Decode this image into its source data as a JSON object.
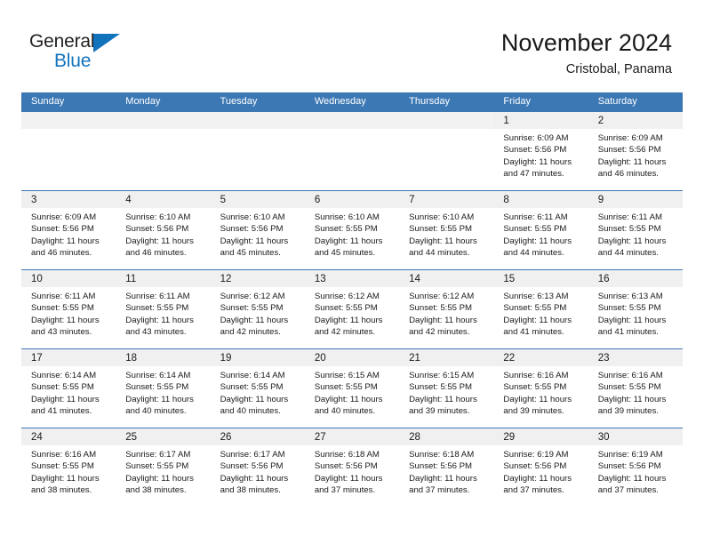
{
  "brand": {
    "name_part1": "General",
    "name_part2": "Blue",
    "triangle_color": "#1273bd"
  },
  "header": {
    "title": "November 2024",
    "subtitle": "Cristobal, Panama"
  },
  "theme": {
    "header_blue": "#3c78b4",
    "daynum_band": "#f0f0f0",
    "text": "#1a1a1a"
  },
  "weekday_headers": [
    "Sunday",
    "Monday",
    "Tuesday",
    "Wednesday",
    "Thursday",
    "Friday",
    "Saturday"
  ],
  "weeks": [
    [
      {
        "day": "",
        "lines": []
      },
      {
        "day": "",
        "lines": []
      },
      {
        "day": "",
        "lines": []
      },
      {
        "day": "",
        "lines": []
      },
      {
        "day": "",
        "lines": []
      },
      {
        "day": "1",
        "lines": [
          "Sunrise: 6:09 AM",
          "Sunset: 5:56 PM",
          "Daylight: 11 hours",
          "and 47 minutes."
        ]
      },
      {
        "day": "2",
        "lines": [
          "Sunrise: 6:09 AM",
          "Sunset: 5:56 PM",
          "Daylight: 11 hours",
          "and 46 minutes."
        ]
      }
    ],
    [
      {
        "day": "3",
        "lines": [
          "Sunrise: 6:09 AM",
          "Sunset: 5:56 PM",
          "Daylight: 11 hours",
          "and 46 minutes."
        ]
      },
      {
        "day": "4",
        "lines": [
          "Sunrise: 6:10 AM",
          "Sunset: 5:56 PM",
          "Daylight: 11 hours",
          "and 46 minutes."
        ]
      },
      {
        "day": "5",
        "lines": [
          "Sunrise: 6:10 AM",
          "Sunset: 5:56 PM",
          "Daylight: 11 hours",
          "and 45 minutes."
        ]
      },
      {
        "day": "6",
        "lines": [
          "Sunrise: 6:10 AM",
          "Sunset: 5:55 PM",
          "Daylight: 11 hours",
          "and 45 minutes."
        ]
      },
      {
        "day": "7",
        "lines": [
          "Sunrise: 6:10 AM",
          "Sunset: 5:55 PM",
          "Daylight: 11 hours",
          "and 44 minutes."
        ]
      },
      {
        "day": "8",
        "lines": [
          "Sunrise: 6:11 AM",
          "Sunset: 5:55 PM",
          "Daylight: 11 hours",
          "and 44 minutes."
        ]
      },
      {
        "day": "9",
        "lines": [
          "Sunrise: 6:11 AM",
          "Sunset: 5:55 PM",
          "Daylight: 11 hours",
          "and 44 minutes."
        ]
      }
    ],
    [
      {
        "day": "10",
        "lines": [
          "Sunrise: 6:11 AM",
          "Sunset: 5:55 PM",
          "Daylight: 11 hours",
          "and 43 minutes."
        ]
      },
      {
        "day": "11",
        "lines": [
          "Sunrise: 6:11 AM",
          "Sunset: 5:55 PM",
          "Daylight: 11 hours",
          "and 43 minutes."
        ]
      },
      {
        "day": "12",
        "lines": [
          "Sunrise: 6:12 AM",
          "Sunset: 5:55 PM",
          "Daylight: 11 hours",
          "and 42 minutes."
        ]
      },
      {
        "day": "13",
        "lines": [
          "Sunrise: 6:12 AM",
          "Sunset: 5:55 PM",
          "Daylight: 11 hours",
          "and 42 minutes."
        ]
      },
      {
        "day": "14",
        "lines": [
          "Sunrise: 6:12 AM",
          "Sunset: 5:55 PM",
          "Daylight: 11 hours",
          "and 42 minutes."
        ]
      },
      {
        "day": "15",
        "lines": [
          "Sunrise: 6:13 AM",
          "Sunset: 5:55 PM",
          "Daylight: 11 hours",
          "and 41 minutes."
        ]
      },
      {
        "day": "16",
        "lines": [
          "Sunrise: 6:13 AM",
          "Sunset: 5:55 PM",
          "Daylight: 11 hours",
          "and 41 minutes."
        ]
      }
    ],
    [
      {
        "day": "17",
        "lines": [
          "Sunrise: 6:14 AM",
          "Sunset: 5:55 PM",
          "Daylight: 11 hours",
          "and 41 minutes."
        ]
      },
      {
        "day": "18",
        "lines": [
          "Sunrise: 6:14 AM",
          "Sunset: 5:55 PM",
          "Daylight: 11 hours",
          "and 40 minutes."
        ]
      },
      {
        "day": "19",
        "lines": [
          "Sunrise: 6:14 AM",
          "Sunset: 5:55 PM",
          "Daylight: 11 hours",
          "and 40 minutes."
        ]
      },
      {
        "day": "20",
        "lines": [
          "Sunrise: 6:15 AM",
          "Sunset: 5:55 PM",
          "Daylight: 11 hours",
          "and 40 minutes."
        ]
      },
      {
        "day": "21",
        "lines": [
          "Sunrise: 6:15 AM",
          "Sunset: 5:55 PM",
          "Daylight: 11 hours",
          "and 39 minutes."
        ]
      },
      {
        "day": "22",
        "lines": [
          "Sunrise: 6:16 AM",
          "Sunset: 5:55 PM",
          "Daylight: 11 hours",
          "and 39 minutes."
        ]
      },
      {
        "day": "23",
        "lines": [
          "Sunrise: 6:16 AM",
          "Sunset: 5:55 PM",
          "Daylight: 11 hours",
          "and 39 minutes."
        ]
      }
    ],
    [
      {
        "day": "24",
        "lines": [
          "Sunrise: 6:16 AM",
          "Sunset: 5:55 PM",
          "Daylight: 11 hours",
          "and 38 minutes."
        ]
      },
      {
        "day": "25",
        "lines": [
          "Sunrise: 6:17 AM",
          "Sunset: 5:55 PM",
          "Daylight: 11 hours",
          "and 38 minutes."
        ]
      },
      {
        "day": "26",
        "lines": [
          "Sunrise: 6:17 AM",
          "Sunset: 5:56 PM",
          "Daylight: 11 hours",
          "and 38 minutes."
        ]
      },
      {
        "day": "27",
        "lines": [
          "Sunrise: 6:18 AM",
          "Sunset: 5:56 PM",
          "Daylight: 11 hours",
          "and 37 minutes."
        ]
      },
      {
        "day": "28",
        "lines": [
          "Sunrise: 6:18 AM",
          "Sunset: 5:56 PM",
          "Daylight: 11 hours",
          "and 37 minutes."
        ]
      },
      {
        "day": "29",
        "lines": [
          "Sunrise: 6:19 AM",
          "Sunset: 5:56 PM",
          "Daylight: 11 hours",
          "and 37 minutes."
        ]
      },
      {
        "day": "30",
        "lines": [
          "Sunrise: 6:19 AM",
          "Sunset: 5:56 PM",
          "Daylight: 11 hours",
          "and 37 minutes."
        ]
      }
    ]
  ]
}
